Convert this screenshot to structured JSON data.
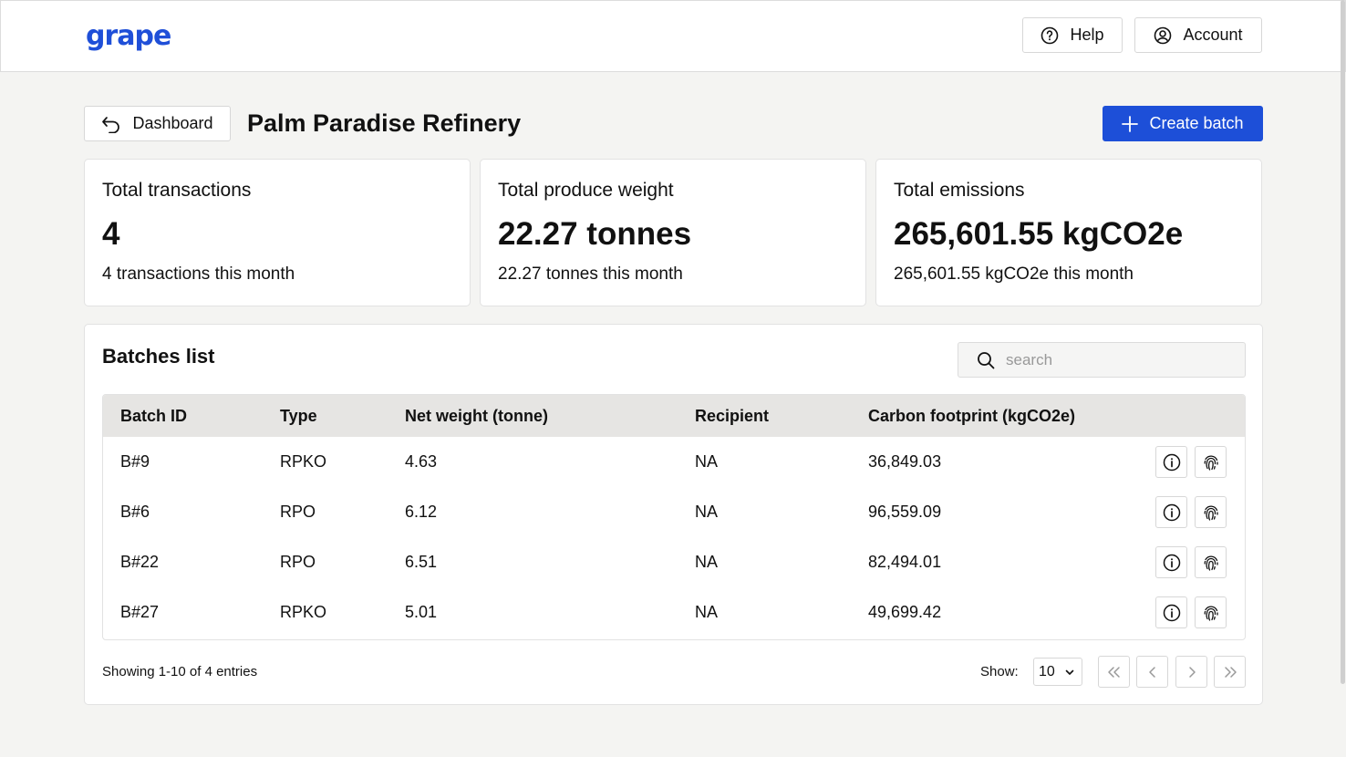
{
  "header": {
    "logo": "grape",
    "help_label": "Help",
    "account_label": "Account"
  },
  "toolbar": {
    "back_label": "Dashboard",
    "title": "Palm Paradise Refinery",
    "create_label": "Create batch"
  },
  "stats": [
    {
      "label": "Total transactions",
      "value": "4",
      "sub": "4 transactions this month"
    },
    {
      "label": "Total produce weight",
      "value": "22.27 tonnes",
      "sub": "22.27 tonnes this month"
    },
    {
      "label": "Total emissions",
      "value": "265,601.55 kgCO2e",
      "sub": "265,601.55 kgCO2e this month"
    }
  ],
  "batches": {
    "title": "Batches list",
    "search_placeholder": "search",
    "columns": [
      "Batch ID",
      "Type",
      "Net weight (tonne)",
      "Recipient",
      "Carbon footprint (kgCO2e)"
    ],
    "rows": [
      [
        "B#9",
        "RPKO",
        "4.63",
        "NA",
        "36,849.03"
      ],
      [
        "B#6",
        "RPO",
        "6.12",
        "NA",
        "96,559.09"
      ],
      [
        "B#22",
        "RPO",
        "6.51",
        "NA",
        "82,494.01"
      ],
      [
        "B#27",
        "RPKO",
        "5.01",
        "NA",
        "49,699.42"
      ]
    ],
    "row_icons": [
      "info-icon",
      "fingerprint-icon"
    ]
  },
  "footer": {
    "showing": "Showing 1-10 of 4 entries",
    "show_label": "Show:",
    "page_size": "10"
  },
  "colors": {
    "brand": "#1f4fd8",
    "primary_button": "#1d4fd8",
    "page_bg": "#f4f4f2",
    "table_header_bg": "#e6e5e3"
  }
}
